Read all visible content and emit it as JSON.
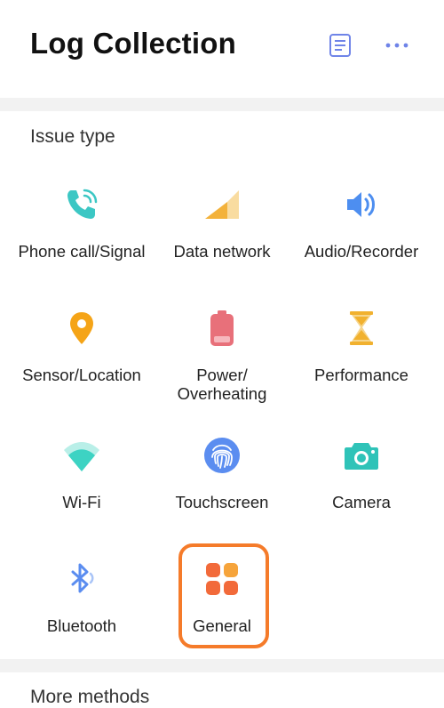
{
  "header": {
    "title": "Log Collection"
  },
  "issue_section": {
    "title": "Issue type"
  },
  "items": [
    {
      "label": "Phone call/Signal"
    },
    {
      "label": "Data network"
    },
    {
      "label": "Audio/Recorder"
    },
    {
      "label": "Sensor/Location"
    },
    {
      "label": "Power/\nOverheating"
    },
    {
      "label": "Performance"
    },
    {
      "label": "Wi-Fi"
    },
    {
      "label": "Touchscreen"
    },
    {
      "label": "Camera"
    },
    {
      "label": "Bluetooth"
    },
    {
      "label": "General"
    }
  ],
  "more_section": {
    "title": "More methods"
  },
  "colors": {
    "highlight": "#f57b2a",
    "header_icon": "#6f84e8"
  },
  "icons": [
    "notes-icon",
    "more-options-icon",
    "phone-call-icon",
    "signal-bars-icon",
    "speaker-icon",
    "location-pin-icon",
    "battery-icon",
    "hourglass-icon",
    "wifi-icon",
    "fingerprint-icon",
    "camera-icon",
    "bluetooth-icon",
    "grid-icon"
  ]
}
